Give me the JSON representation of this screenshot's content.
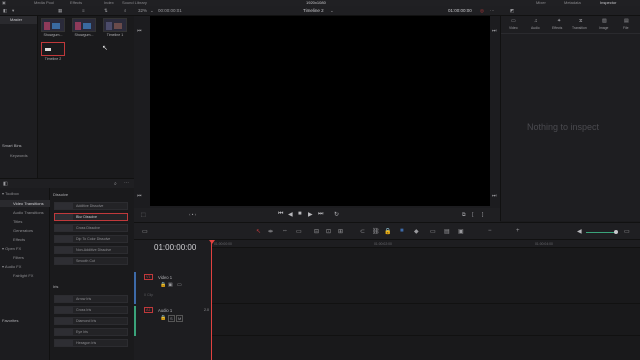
{
  "app": {
    "top_title": "1920x1080",
    "top_items": [
      "Media Pool",
      "Effects",
      "Index",
      "Sound Library"
    ],
    "top_right_items": [
      "Mixer",
      "Metadata",
      "Inspector"
    ]
  },
  "toolbar": {
    "zoom": "32%",
    "source_timecode": "00:00:00:01",
    "timeline_name": "Timeline 2",
    "record_timecode": "01:00:00:00"
  },
  "bins": {
    "master": "Master",
    "smart_bins": "Smart Bins",
    "keywords": "Keywords",
    "favorites": "Favorites"
  },
  "media_pool": {
    "clips": [
      {
        "label": "Showgum..."
      },
      {
        "label": "Showgum..."
      },
      {
        "label": "Timeline 1"
      },
      {
        "label": "Timeline 2"
      }
    ]
  },
  "inspector": {
    "tabs": [
      "Video",
      "Audio",
      "Effects",
      "Transition",
      "Image",
      "File"
    ],
    "empty_text": "Nothing to inspect"
  },
  "effects": {
    "tree": [
      {
        "label": "Toolbox",
        "indent": 0
      },
      {
        "label": "Video Transitions",
        "indent": 1
      },
      {
        "label": "Audio Transitions",
        "indent": 1
      },
      {
        "label": "Titles",
        "indent": 1
      },
      {
        "label": "Generators",
        "indent": 1
      },
      {
        "label": "Effects",
        "indent": 1
      },
      {
        "label": "Open FX",
        "indent": 0
      },
      {
        "label": "Filters",
        "indent": 1
      },
      {
        "label": "Audio FX",
        "indent": 0
      },
      {
        "label": "Fairlight FX",
        "indent": 1
      }
    ],
    "dissolve_header": "Dissolve",
    "dissolves": [
      "Additive Dissolve",
      "Blur Dissolve",
      "Cross Dissolve",
      "Dip To Color Dissolve",
      "Non-Additive Dissolve",
      "Smooth Cut"
    ],
    "iris_header": "Iris",
    "iris": [
      "Arrow Iris",
      "Cross Iris",
      "Diamond Iris",
      "Eye Iris",
      "Hexagon Iris"
    ]
  },
  "timeline": {
    "timecode": "01:00:00:00",
    "ruler": [
      "01:00:00:00",
      "01:00:02:00",
      "01:00:04:00"
    ],
    "video_track": {
      "id": "V1",
      "name": "Video 1",
      "clips": "0 Clip"
    },
    "audio_track": {
      "id": "A1",
      "name": "Audio 1",
      "level": "2.0"
    }
  },
  "colors": {
    "accent_red": "#c0393b",
    "playhead": "#e0413f",
    "video_track_accent": "#3d6aa8",
    "audio_track_accent": "#3aa37a"
  }
}
